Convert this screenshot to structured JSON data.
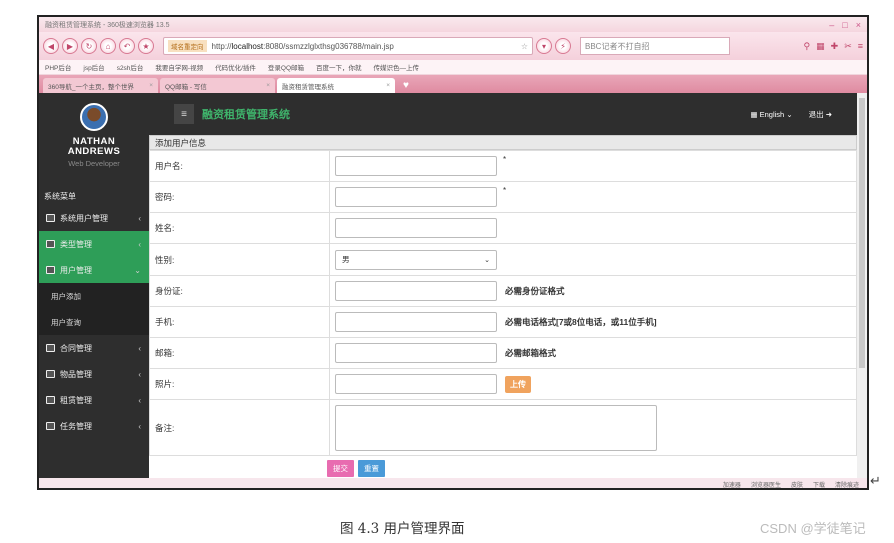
{
  "browser": {
    "window_title": "融资租赁管理系统 - 360极速浏览器 13.5",
    "address_tag": "域名重定向",
    "url_prefix": "http://",
    "url_host": "localhost",
    "url_rest": ":8080/ssmzzlglxthsg036788/main.jsp",
    "search_placeholder": "BBC记者不打自招",
    "bookmarks": [
      "PHP后台",
      "jsp后台",
      "s2sh后台",
      "我要自学网-视频",
      "代码优化/插件",
      "登录QQ邮箱",
      "百度一下，你就",
      "传媒识色—上传"
    ],
    "tabs": [
      {
        "label": "360导航_一个主页，整个世界"
      },
      {
        "label": "QQ邮箱 - 写信"
      },
      {
        "label": "融资租赁管理系统"
      }
    ],
    "status_items": [
      "加速器",
      "浏览器医生",
      "皮肤",
      "下载",
      "清除痕迹"
    ]
  },
  "sidebar": {
    "name_line1": "NATHAN",
    "name_line2": "ANDREWS",
    "role": "Web Developer",
    "menu_title": "系统菜单",
    "items": [
      {
        "label": "系统用户管理"
      },
      {
        "label": "类型管理"
      },
      {
        "label": "用户管理"
      },
      {
        "label": "合同管理"
      },
      {
        "label": "物品管理"
      },
      {
        "label": "租赁管理"
      },
      {
        "label": "任务管理"
      }
    ],
    "subitems": [
      "用户添加",
      "用户查询"
    ]
  },
  "header": {
    "brand": "融资租赁管理系统",
    "language": "English",
    "logout": "退出"
  },
  "form": {
    "title": "添加用户信息",
    "required_mark": "*",
    "fields": [
      {
        "label": "用户名:"
      },
      {
        "label": "密码:"
      },
      {
        "label": "姓名:"
      },
      {
        "label": "性别:",
        "value": "男"
      },
      {
        "label": "身份证:",
        "hint": "必需身份证格式"
      },
      {
        "label": "手机:",
        "hint": "必需电话格式[7或8位电话，或11位手机]"
      },
      {
        "label": "邮箱:",
        "hint": "必需邮箱格式"
      },
      {
        "label": "照片:",
        "button": "上传"
      },
      {
        "label": "备注:"
      }
    ],
    "submit": "提交",
    "reset": "重置"
  },
  "document": {
    "caption": "图 4.3 用户管理界面",
    "watermark": "CSDN @学徒笔记"
  }
}
